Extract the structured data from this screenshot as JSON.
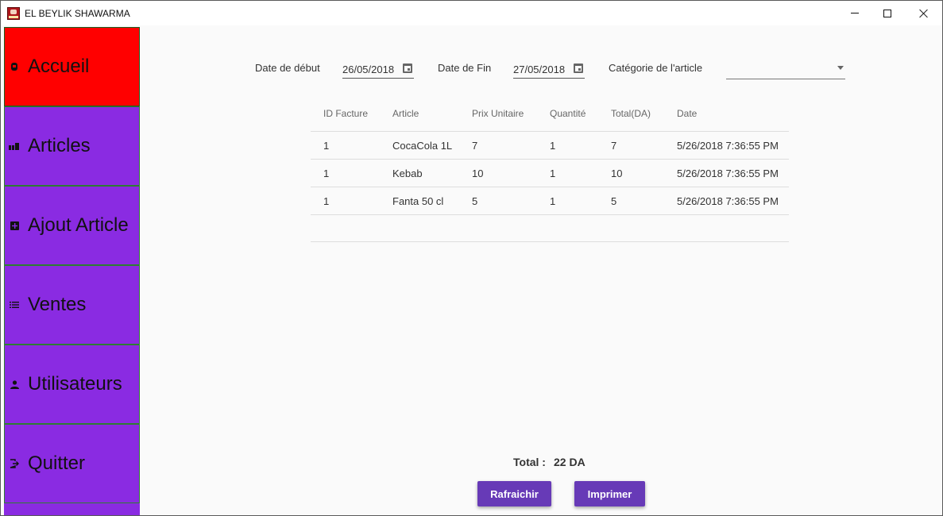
{
  "window": {
    "title": "EL BEYLIK SHAWARMA"
  },
  "sidebar": {
    "items": [
      {
        "label": "Accueil",
        "icon": "home-icon",
        "active": true
      },
      {
        "label": "Articles",
        "icon": "articles-icon",
        "active": false
      },
      {
        "label": "Ajout Article",
        "icon": "add-box-icon",
        "active": false
      },
      {
        "label": "Ventes",
        "icon": "list-icon",
        "active": false
      },
      {
        "label": "Utilisateurs",
        "icon": "user-icon",
        "active": false
      },
      {
        "label": "Quitter",
        "icon": "exit-icon",
        "active": false
      }
    ]
  },
  "filters": {
    "start_label": "Date de début",
    "start_value": "26/05/2018",
    "end_label": "Date de Fin",
    "end_value": "27/05/2018",
    "category_label": "Catégorie de l'article",
    "category_value": ""
  },
  "table": {
    "headers": [
      "ID Facture",
      "Article",
      "Prix Unitaire",
      "Quantité",
      "Total(DA)",
      "Date"
    ],
    "rows": [
      [
        "1",
        "CocaCola 1L",
        "7",
        "1",
        "7",
        "5/26/2018 7:36:55 PM"
      ],
      [
        "1",
        "Kebab",
        "10",
        "1",
        "10",
        "5/26/2018 7:36:55 PM"
      ],
      [
        "1",
        "Fanta 50 cl",
        "5",
        "1",
        "5",
        "5/26/2018 7:36:55 PM"
      ]
    ]
  },
  "summary": {
    "total_label": "Total :",
    "total_value": "22 DA"
  },
  "buttons": {
    "refresh_label": "Rafraichir",
    "print_label": "Imprimer"
  },
  "colors": {
    "sidebar_bg": "#8a2be2",
    "active_bg": "#ff0000",
    "button_bg": "#673ab7"
  }
}
